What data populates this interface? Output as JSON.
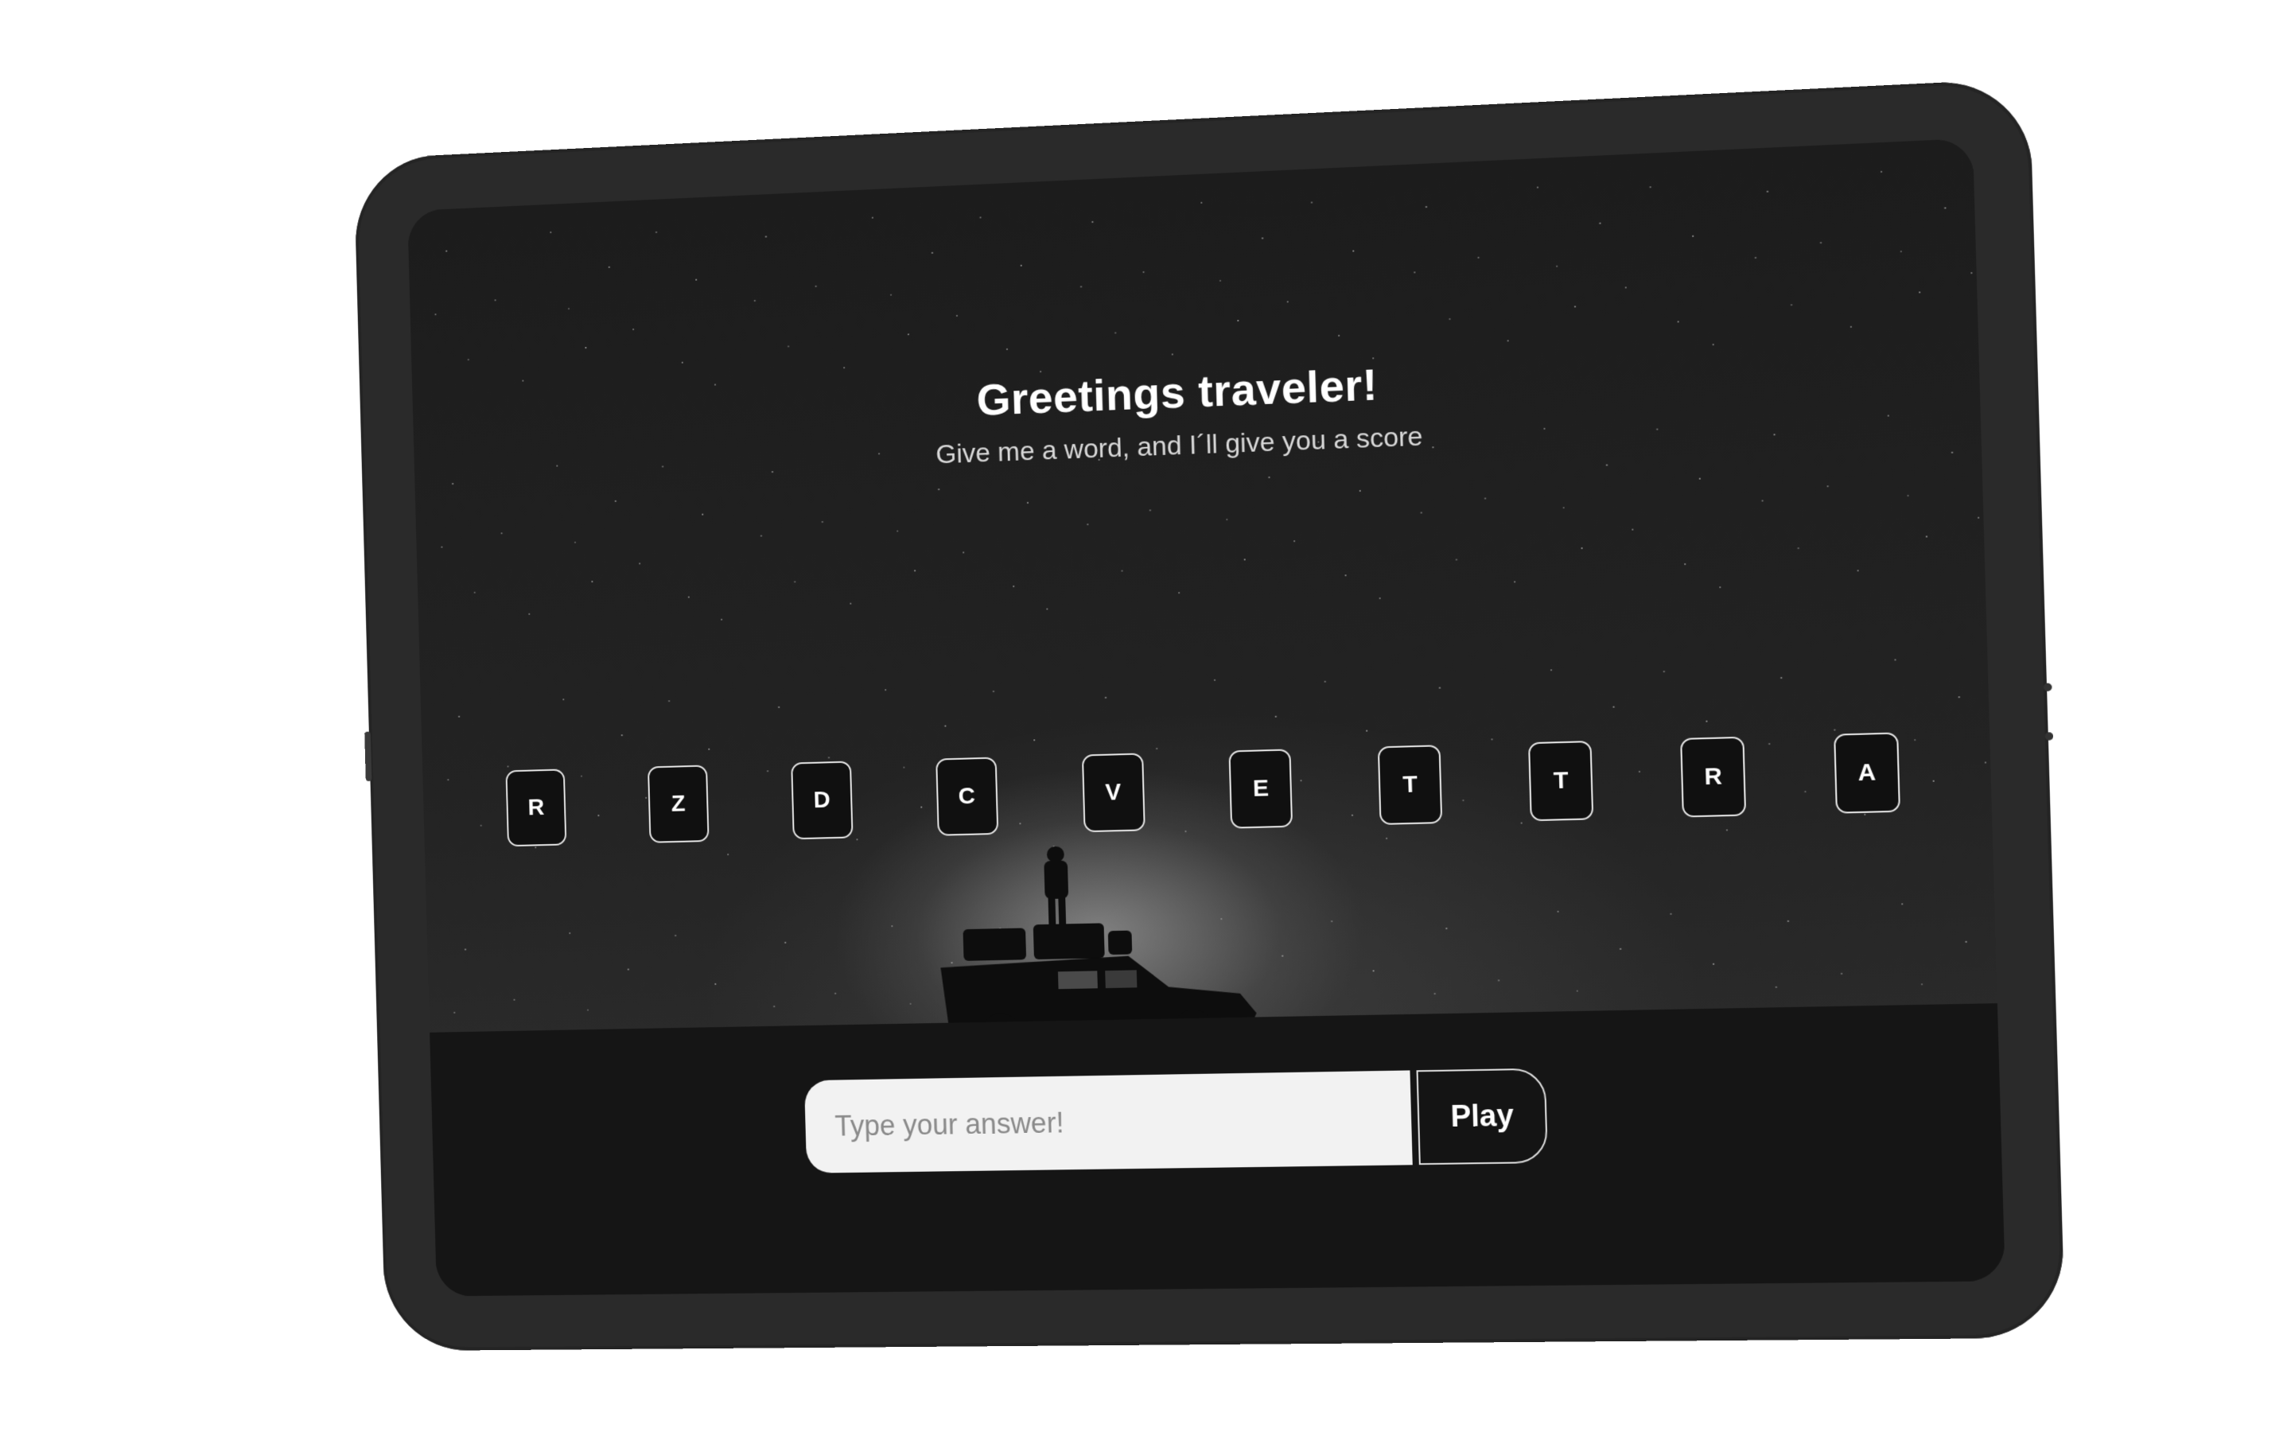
{
  "hero": {
    "title": "Greetings traveler!",
    "subtitle": "Give me a word, and I´ll give you a score"
  },
  "letters": [
    "R",
    "Z",
    "D",
    "C",
    "V",
    "E",
    "T",
    "T",
    "R",
    "A"
  ],
  "answer": {
    "placeholder": "Type your answer!",
    "value": "",
    "play_label": "Play"
  },
  "colors": {
    "device_frame": "#2a2a2a",
    "screen_bg": "#151515",
    "tile_border": "#e8e8e8",
    "input_bg": "#f2f2f2"
  }
}
